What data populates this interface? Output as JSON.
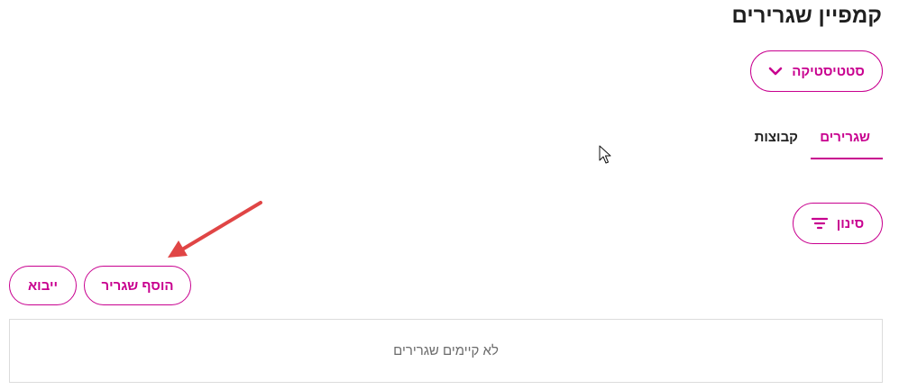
{
  "page": {
    "title": "קמפיין שגרירים"
  },
  "toolbar": {
    "statistics_label": "סטטיסטיקה",
    "filter_label": "סינון",
    "add_ambassador_label": "הוסף שגריר",
    "import_label": "ייבוא"
  },
  "tabs": [
    {
      "label": "שגרירים",
      "active": true
    },
    {
      "label": "קבוצות",
      "active": false
    }
  ],
  "list": {
    "empty_message": "לא קיימים שגרירים"
  },
  "colors": {
    "accent": "#c8008f",
    "annotation": "#e04545",
    "border": "#dcdcdc"
  },
  "icons": {
    "statistics": "chevron-down-icon",
    "filter": "filter-icon",
    "cursor": "mouse-pointer-icon",
    "annotation": "red-arrow-annotation"
  }
}
